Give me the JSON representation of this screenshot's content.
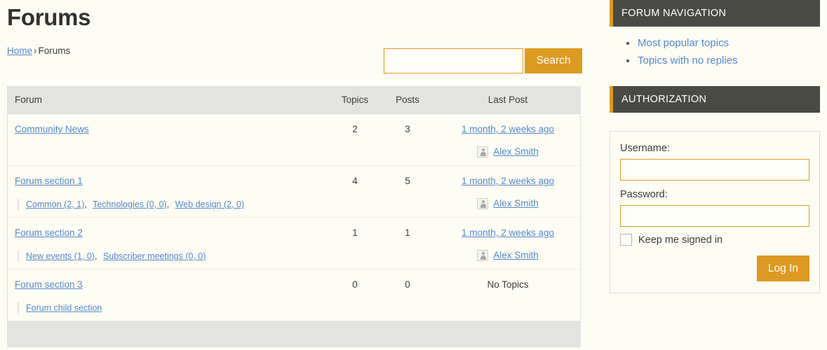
{
  "header": {
    "title": "Forums",
    "breadcrumb": {
      "home": "Home",
      "separator": "›",
      "current": "Forums"
    }
  },
  "search": {
    "value": "",
    "placeholder": "",
    "button_label": "Search"
  },
  "forum_table": {
    "columns": {
      "forum": "Forum",
      "topics": "Topics",
      "posts": "Posts",
      "last_post": "Last Post"
    },
    "rows": [
      {
        "name": "Community News",
        "subforums": [],
        "topics": "2",
        "posts": "3",
        "last_post_time": "1 month, 2 weeks ago",
        "last_post_author": "Alex Smith",
        "no_topics_label": ""
      },
      {
        "name": "Forum section 1",
        "subforums": [
          {
            "label": "Common (2, 1)",
            "separator": ","
          },
          {
            "label": "Technologies (0, 0)",
            "separator": ","
          },
          {
            "label": "Web design (2, 0)",
            "separator": ""
          }
        ],
        "topics": "4",
        "posts": "5",
        "last_post_time": "1 month, 2 weeks ago",
        "last_post_author": "Alex Smith",
        "no_topics_label": ""
      },
      {
        "name": "Forum section 2",
        "subforums": [
          {
            "label": "New events (1, 0)",
            "separator": ","
          },
          {
            "label": "Subscriber meetings (0, 0)",
            "separator": ""
          }
        ],
        "topics": "1",
        "posts": "1",
        "last_post_time": "1 month, 2 weeks ago",
        "last_post_author": "Alex Smith",
        "no_topics_label": ""
      },
      {
        "name": "Forum section 3",
        "subforums": [
          {
            "label": "Forum child section",
            "separator": ""
          }
        ],
        "topics": "0",
        "posts": "0",
        "last_post_time": "",
        "last_post_author": "",
        "no_topics_label": "No Topics"
      }
    ]
  },
  "sidebar": {
    "forum_navigation": {
      "title": "FORUM NAVIGATION",
      "items": [
        {
          "label": "Most popular topics"
        },
        {
          "label": "Topics with no replies"
        }
      ]
    },
    "authorization": {
      "title": "AUTHORIZATION",
      "username_label": "Username:",
      "username_value": "",
      "password_label": "Password:",
      "password_value": "",
      "keep_signed_in_label": "Keep me signed in",
      "keep_signed_in_checked": false,
      "login_button_label": "Log In"
    }
  },
  "colors": {
    "accent": "#dd9a22",
    "widget_header": "#4a4a45",
    "link": "#5588cc",
    "table_header_bg": "#e3e3e0",
    "page_bg": "#fdfdf4"
  }
}
